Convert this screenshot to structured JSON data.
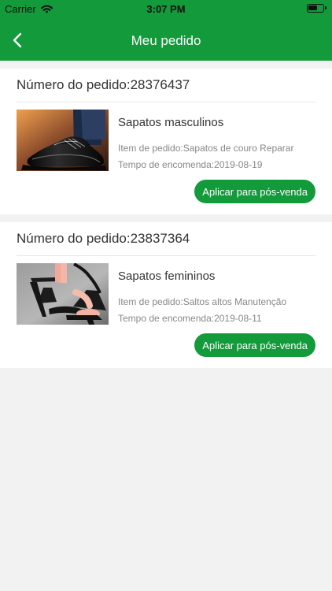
{
  "status_bar": {
    "carrier": "Carrier",
    "time": "3:07 PM"
  },
  "header": {
    "title": "Meu pedido"
  },
  "orders": [
    {
      "order_label": "Número do pedido:28376437",
      "item_name": "Sapatos masculinos",
      "item_detail": "Item de pedido:Sapatos de couro Reparar",
      "order_time": "Tempo de encomenda:2019-08-19",
      "button_label": "Aplicar para pós-venda",
      "image_icon": "men-dress-shoe"
    },
    {
      "order_label": "Número do pedido:23837364",
      "item_name": "Sapatos femininos",
      "item_detail": "Item de pedido:Saltos altos Manutenção",
      "order_time": "Tempo de encomenda:2019-08-11",
      "button_label": "Aplicar para pós-venda",
      "image_icon": "women-heel-sandal"
    }
  ],
  "colors": {
    "brand": "#139a3b",
    "background": "#f2f2f2"
  }
}
